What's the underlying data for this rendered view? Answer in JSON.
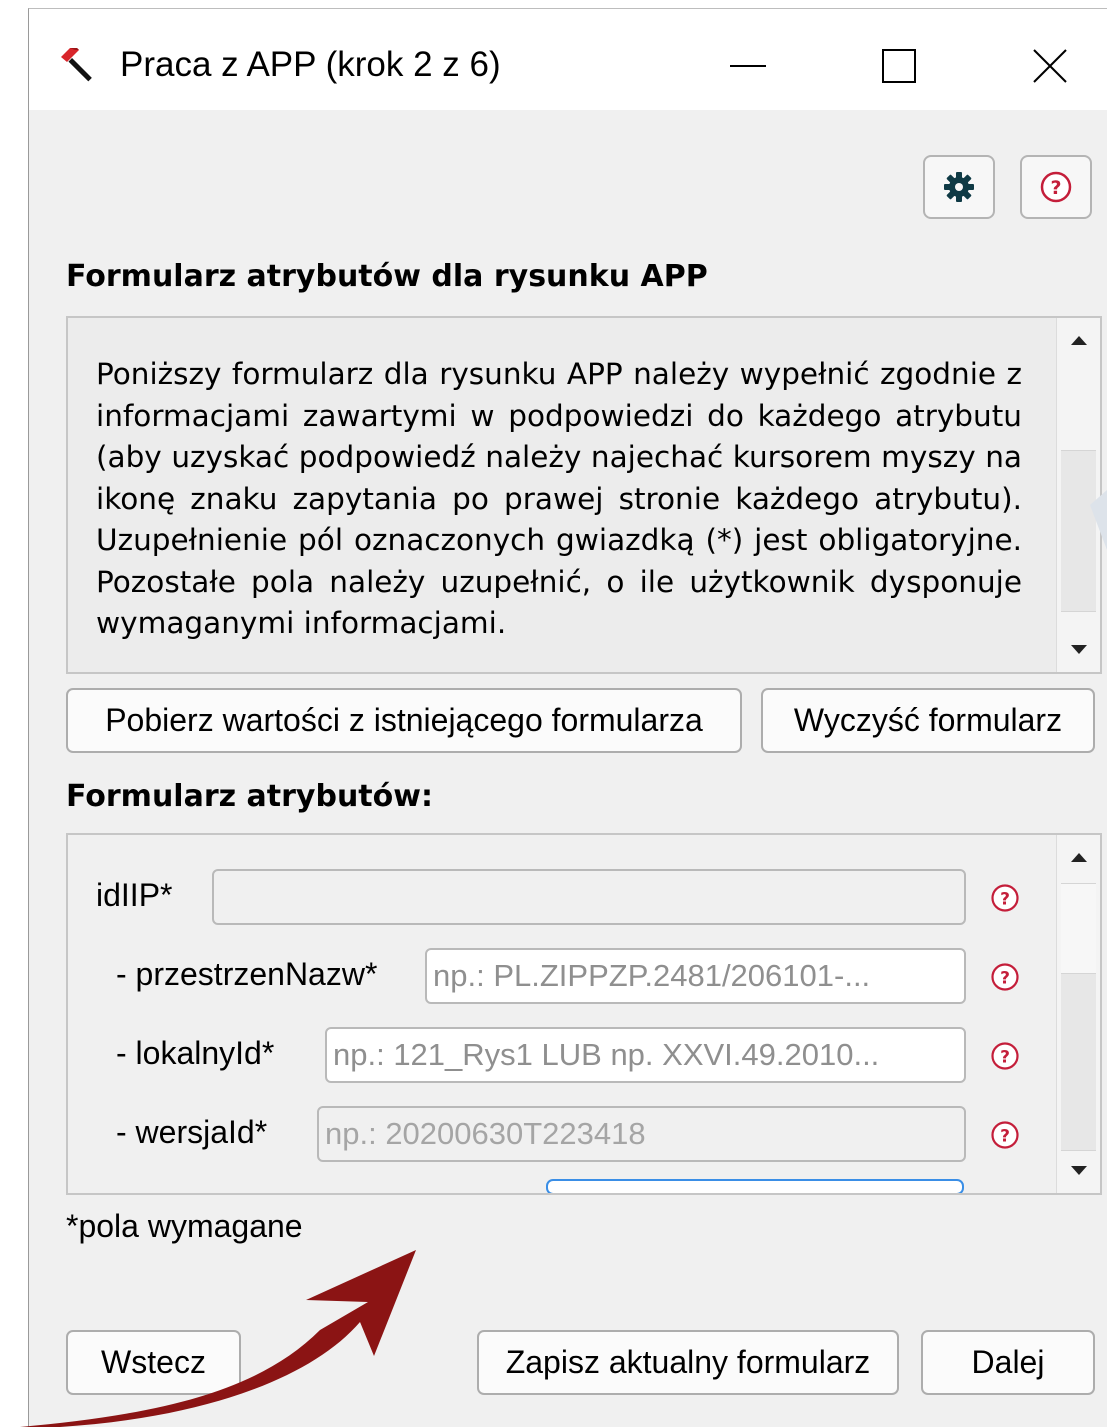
{
  "window": {
    "title": "Praca z APP (krok 2 z 6)",
    "icon": "hammer-icon"
  },
  "toolbar": {
    "settings_icon": "gear-icon",
    "help_icon": "question-icon"
  },
  "description_section": {
    "heading": "Formularz atrybutów dla rysunku APP",
    "text": "Poniższy formularz dla rysunku APP należy wypełnić zgodnie z informacjami zawartymi w podpowiedzi do każdego atrybutu (aby uzyskać podpowiedź należy najechać kursorem myszy na ikonę znaku zapytania po prawej stronie każdego atrybutu). Uzupełnienie pól oznaczonych gwiazdką (*) jest obligatoryjne. Pozostałe pola należy uzupełnić, o ile użytkownik dysponuje wymaganymi informacjami."
  },
  "actions": {
    "load_label": "Pobierz wartości z istniejącego formularza",
    "clear_label": "Wyczyść formularz"
  },
  "form": {
    "heading": "Formularz atrybutów:",
    "fields": [
      {
        "label": "idIIP*",
        "value": "",
        "placeholder": ""
      },
      {
        "label": "- przestrzenNazw*",
        "value": "",
        "placeholder": "np.: PL.ZIPPZP.2481/206101-..."
      },
      {
        "label": "- lokalnyId*",
        "value": "",
        "placeholder": "np.: 121_Rys1 LUB np. XXVI.49.2010..."
      },
      {
        "label": "- wersjaId*",
        "value": "",
        "placeholder": "np.: 20200630T223418"
      }
    ],
    "footnote": "*pola wymagane"
  },
  "footer": {
    "back_label": "Wstecz",
    "save_label": "Zapisz aktualny formularz",
    "next_label": "Dalej"
  },
  "colors": {
    "accent_arrow": "#8b1414",
    "help_icon": "#c41e3a",
    "gear_icon": "#0f3a45"
  }
}
